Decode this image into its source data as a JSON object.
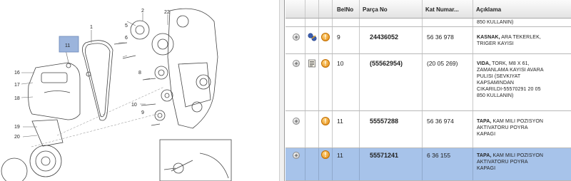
{
  "diagram": {
    "callouts": [
      "1",
      "2",
      "5",
      "6",
      "8",
      "9",
      "10",
      "11",
      "16",
      "17",
      "18",
      "19",
      "20",
      "22"
    ]
  },
  "table": {
    "headers": {
      "belno": "BelNo",
      "parca_no": "Parça No",
      "kat_numarasi": "Kat Numar...",
      "aciklama": "Açıklama"
    },
    "rows": [
      {
        "belno": "",
        "parca_no": "",
        "kat": "",
        "aciklama_bold": "",
        "aciklama": "850 KULLANIN)"
      },
      {
        "belno": "9",
        "parca_no": "24436052",
        "kat": "56 36 978",
        "aciklama_bold": "KASNAK,",
        "aciklama": " ARA TEKERLEK,\nTRIGER KAYISI"
      },
      {
        "belno": "10",
        "parca_no": "(55562954)",
        "kat": "(20 05 269)",
        "aciklama_bold": "VIDA,",
        "aciklama": " TORK, M8 X 61,\nZAMANLAMA KAYISI AVARA\nPULISI (SEVKIYAT\nKAPSAMINDAN\nCIKARILDI-55570291 20 05\n850 KULLANIN)"
      },
      {
        "belno": "11",
        "parca_no": "55557288",
        "kat": "56 36 974",
        "aciklama_bold": "TAPA,",
        "aciklama": " KAM MILI POZISYON\nAKTIVATORU POYRA\nKAPAGI"
      },
      {
        "belno": "11",
        "parca_no": "55571241",
        "kat": "6 36 155",
        "aciklama_bold": "TAPA,",
        "aciklama": " KAM MILI POZISYON\nAKTIVATORU POYRA\nKAPAGI"
      }
    ]
  },
  "colors": {
    "selected_row": "#a7c3ea",
    "callout_highlight": "#9bb4dc",
    "warning": "#e38a10"
  }
}
